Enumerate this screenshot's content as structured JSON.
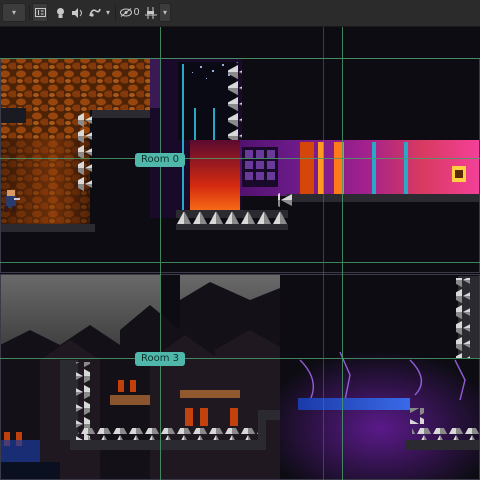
{
  "toolbar": {
    "items": [
      {
        "name": "toggle-2d-button",
        "icon": "grid-2d-icon"
      },
      {
        "name": "lighting-toggle-button",
        "icon": "lightbulb-icon"
      },
      {
        "name": "audio-toggle-button",
        "icon": "speaker-icon"
      },
      {
        "name": "effects-toggle-button",
        "icon": "effects-icon"
      },
      {
        "name": "hidden-objects-toggle-button",
        "icon": "eye-slash-icon",
        "label": "0"
      },
      {
        "name": "grid-snap-toggle-button",
        "icon": "grid-snap-icon"
      }
    ]
  },
  "rooms": [
    {
      "label": "Room 0"
    },
    {
      "label": "Room 3"
    }
  ],
  "colors": {
    "room_label_bg": "#4fb8aa",
    "guide_line": "#4a9a6a",
    "platform": "#2a2a30",
    "spike": "#d8d8d8",
    "background": "#0c0c12"
  }
}
